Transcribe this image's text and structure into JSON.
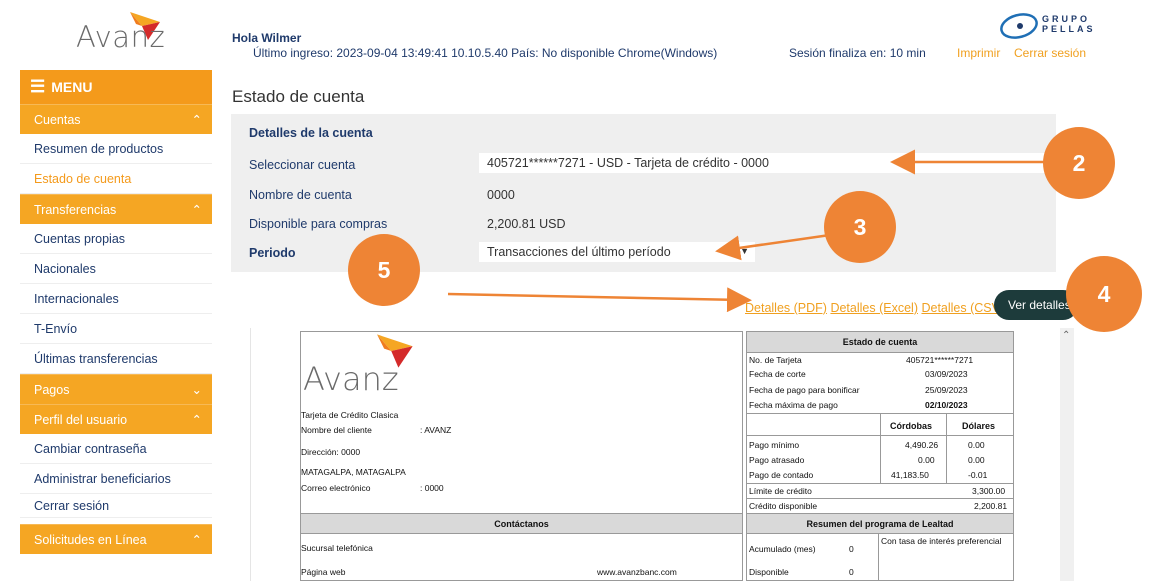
{
  "header": {
    "logo": "Avanz",
    "greeting": "Hola Wilmer",
    "last_login": "Último ingreso: 2023-09-04 13:49:41 10.10.5.40 País: No disponible Chrome(Windows)",
    "session": "Sesión finaliza en: 10 min",
    "print": "Imprimir",
    "logout": "Cerrar sesión",
    "group_logo_1": "GRUPO",
    "group_logo_2": "PELLAS"
  },
  "sidebar": {
    "menu": "MENU",
    "sections": [
      {
        "label": "Cuentas",
        "items": [
          "Resumen de productos",
          "Estado de cuenta"
        ]
      },
      {
        "label": "Transferencias",
        "items": [
          "Cuentas propias",
          "Nacionales",
          "Internacionales",
          "T-Envío",
          "Últimas transferencias"
        ]
      },
      {
        "label": "Pagos",
        "items": []
      },
      {
        "label": "Perfil del usuario",
        "items": [
          "Cambiar contraseña",
          "Administrar beneficiarios",
          "Cerrar sesión"
        ]
      },
      {
        "label": "Solicitudes en Línea",
        "items": []
      }
    ],
    "active_item": "Estado de cuenta"
  },
  "main": {
    "title": "Estado de cuenta",
    "panel_title": "Detalles de la cuenta",
    "select_label": "Seleccionar cuenta",
    "select_value": "405721******7271 - USD - Tarjeta de crédito - 0000",
    "name_label": "Nombre de cuenta",
    "name_value": "0000",
    "available_label": "Disponible para compras",
    "available_value": "2,200.81 USD",
    "period_label": "Periodo",
    "period_value": "Transacciones del último período",
    "link_pdf": "Detalles (PDF)",
    "link_excel": "Detalles (Excel)",
    "link_csv": "Detalles (CSV)",
    "view_button": "Ver detalles",
    "annotations": [
      "2",
      "3",
      "4",
      "5"
    ]
  },
  "statement": {
    "logo": "Avanz",
    "card_type": "Tarjeta de Crédito Clasica",
    "client_label": "Nombre del cliente",
    "client_value": ": AVANZ",
    "address_label": "Dirección: 0000",
    "city": "MATAGALPA, MATAGALPA",
    "email_label": "Correo electrónico",
    "email_value": ": 0000",
    "contact_header": "Contáctanos",
    "phone_branch": "Sucursal telefónica",
    "web_label": "Página web",
    "web_value": "www.avanzbanc.com",
    "account_header": "Estado de cuenta",
    "card_no_label": "No. de Tarjeta",
    "card_no_value": "405721******7271",
    "cut_label": "Fecha de corte",
    "cut_value": "03/09/2023",
    "bonus_label": "Fecha de pago para bonificar",
    "bonus_value": "25/09/2023",
    "max_label": "Fecha máxima de pago",
    "max_value": "02/10/2023",
    "col_cordobas": "Córdobas",
    "col_dolares": "Dólares",
    "rows": [
      {
        "label": "Pago mínimo",
        "cordobas": "4,490.26",
        "dolares": "0.00"
      },
      {
        "label": "Pago atrasado",
        "cordobas": "0.00",
        "dolares": "0.00"
      },
      {
        "label": "Pago de contado",
        "cordobas": "41,183.50",
        "dolares": "-0.01"
      }
    ],
    "limit_label": "Límite de crédito",
    "limit_value": "3,300.00",
    "credit_label": "Crédito disponible",
    "credit_value": "2,200.81",
    "loyalty_header": "Resumen del programa de Lealtad",
    "accum_label": "Acumulado (mes)",
    "accum_value": "0",
    "avail_label": "Disponible",
    "avail_value": "0",
    "rate_note": "Con tasa de interés preferencial"
  }
}
